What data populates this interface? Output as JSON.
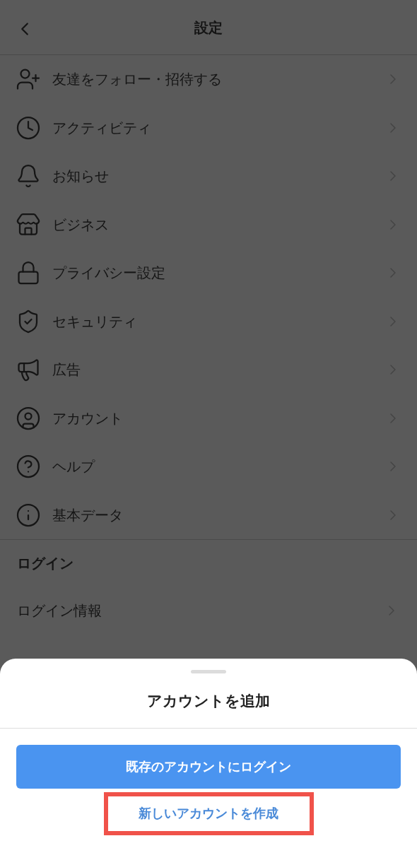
{
  "header": {
    "title": "設定"
  },
  "menu": [
    {
      "label": "友達をフォロー・招待する"
    },
    {
      "label": "アクティビティ"
    },
    {
      "label": "お知らせ"
    },
    {
      "label": "ビジネス"
    },
    {
      "label": "プライバシー設定"
    },
    {
      "label": "セキュリティ"
    },
    {
      "label": "広告"
    },
    {
      "label": "アカウント"
    },
    {
      "label": "ヘルプ"
    },
    {
      "label": "基本データ"
    }
  ],
  "login_section": {
    "heading": "ログイン",
    "items": [
      {
        "label": "ログイン情報"
      }
    ]
  },
  "sheet": {
    "title": "アカウントを追加",
    "primary_button": "既存のアカウントにログイン",
    "secondary_button": {
      "label": "新しいアカウントを作成",
      "highlighted": true
    }
  }
}
